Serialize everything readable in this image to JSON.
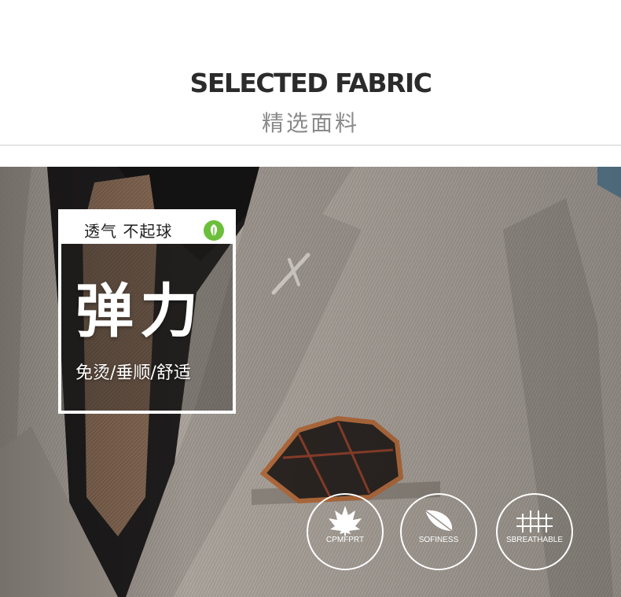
{
  "header": {
    "title_en": "SELECTED FABRIC",
    "title_cn": "精选面料"
  },
  "promo": {
    "top_text": "透气 不起球",
    "big_text": "弹力",
    "sub_text": "免烫/垂顺/舒适",
    "badge_icon": "leaf-icon"
  },
  "features": [
    {
      "label": "CPMFPRT",
      "icon": "maple-leaf-icon"
    },
    {
      "label": "SOFINESS",
      "icon": "feather-icon"
    },
    {
      "label": "SBREATHABLE",
      "icon": "fence-icon"
    }
  ],
  "colors": {
    "suit": "#a29b93",
    "shirt": "#1d1b1b",
    "tie": "#7a5e4b",
    "accent_green": "#6bbf3a"
  }
}
